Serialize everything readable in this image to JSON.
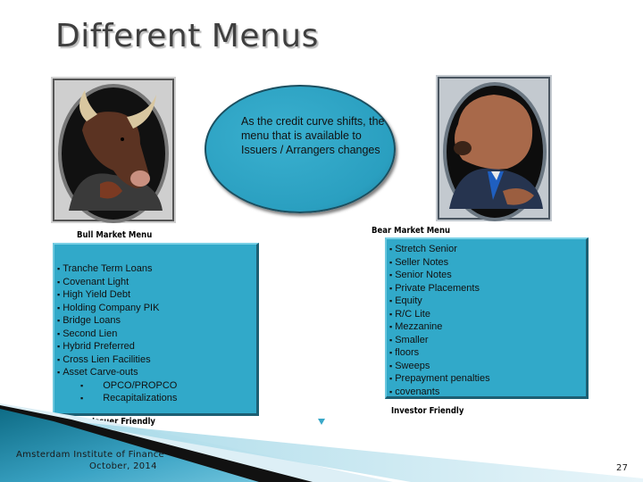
{
  "slide": {
    "title": "Different Menus",
    "page_number": "27"
  },
  "images": {
    "bull": "bull-portrait",
    "bear": "bear-portrait"
  },
  "callout": {
    "text": "As the credit curve shifts, the menu that is available to Issuers / Arrangers changes"
  },
  "bull_menu": {
    "label": "Bull Market Menu",
    "footer_label": "Issuer Friendly",
    "items": [
      "Tranche Term Loans",
      "Covenant Light",
      "High Yield Debt",
      "Holding Company PIK",
      "Bridge Loans",
      "Second Lien",
      "Hybrid Preferred",
      "Cross Lien Facilities",
      "Asset Carve-outs"
    ],
    "sub_items": [
      "OPCO/PROPCO",
      "Recapitalizations"
    ]
  },
  "bear_menu": {
    "label": "Bear Market Menu",
    "footer_label": "Investor Friendly",
    "items": [
      "Stretch Senior",
      "Seller Notes",
      "Senior Notes",
      "Private Placements",
      "Equity",
      "R/C Lite",
      "Mezzanine",
      "Smaller",
      "floors",
      "Sweeps",
      "Prepayment penalties",
      "covenants"
    ]
  },
  "footer": {
    "organization": "Amsterdam Institute of Finance",
    "date": "October, 2014"
  },
  "colors": {
    "box_fill": "#31a9c9",
    "title": "#3f3f3f",
    "accent": "#3aa8c8"
  }
}
